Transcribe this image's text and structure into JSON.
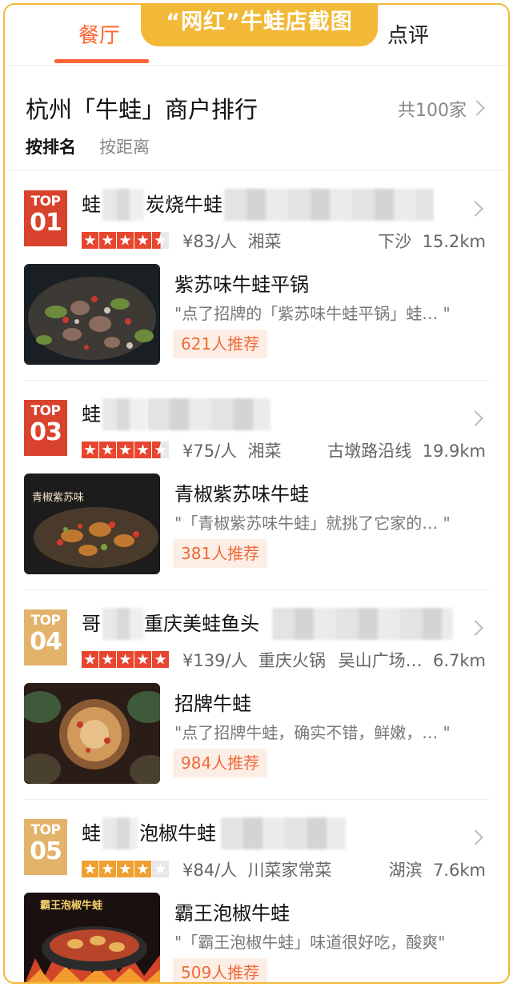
{
  "tabs": {
    "restaurants": "餐厅",
    "banner": "“网红”牛蛙店截图",
    "reviews": "点评"
  },
  "header": {
    "title": "杭州「牛蛙」商户排行",
    "count": "共100家",
    "sort_rank": "按排名",
    "sort_distance": "按距离"
  },
  "shops": [
    {
      "badge_top": "TOP",
      "badge_num": "01",
      "name_prefix": "蛙",
      "name_suffix": "炭烧牛蛙",
      "rating": 4.5,
      "price": "¥83/人",
      "cuisine": "湘菜",
      "area": "下沙",
      "distance": "15.2km",
      "dish": "紫苏味牛蛙平锅",
      "quote": "\"点了招牌的「紫苏味牛蛙平锅」蛙… \"",
      "recommend": "621人推荐"
    },
    {
      "badge_top": "TOP",
      "badge_num": "03",
      "name_prefix": "蛙",
      "name_suffix": "",
      "rating": 4.5,
      "price": "¥75/人",
      "cuisine": "湘菜",
      "area": "古墩路沿线",
      "distance": "19.9km",
      "dish": "青椒紫苏味牛蛙",
      "quote": "\"「青椒紫苏味牛蛙」就挑了它家的… \"",
      "recommend": "381人推荐"
    },
    {
      "badge_top": "TOP",
      "badge_num": "04",
      "name_prefix": "哥",
      "name_suffix": "重庆美蛙鱼头",
      "rating": 5,
      "price": "¥139/人",
      "cuisine": "重庆火锅",
      "area": "吴山广场…",
      "distance": "6.7km",
      "dish": "招牌牛蛙",
      "quote": "\"点了招牌牛蛙，确实不错，鲜嫩，… \"",
      "recommend": "984人推荐"
    },
    {
      "badge_top": "TOP",
      "badge_num": "05",
      "name_prefix": "蛙",
      "name_suffix": "泡椒牛蛙",
      "rating": 4,
      "price": "¥84/人",
      "cuisine": "川菜家常菜",
      "area": "湖滨",
      "distance": "7.6km",
      "dish": "霸王泡椒牛蛙",
      "quote": "\"「霸王泡椒牛蛙」味道很好吃，酸爽\"",
      "recommend": "509人推荐"
    }
  ],
  "photo_text": {
    "shop2": "青椒紫苏味",
    "shop5": "霸王泡椒牛蛙"
  },
  "colors": {
    "accent": "#ff6633",
    "banner": "#f2b938",
    "badge_red": "#d9432d",
    "badge_gold": "#e3b36b",
    "star_red": "#e8452f",
    "star_gold": "#f0a030"
  }
}
